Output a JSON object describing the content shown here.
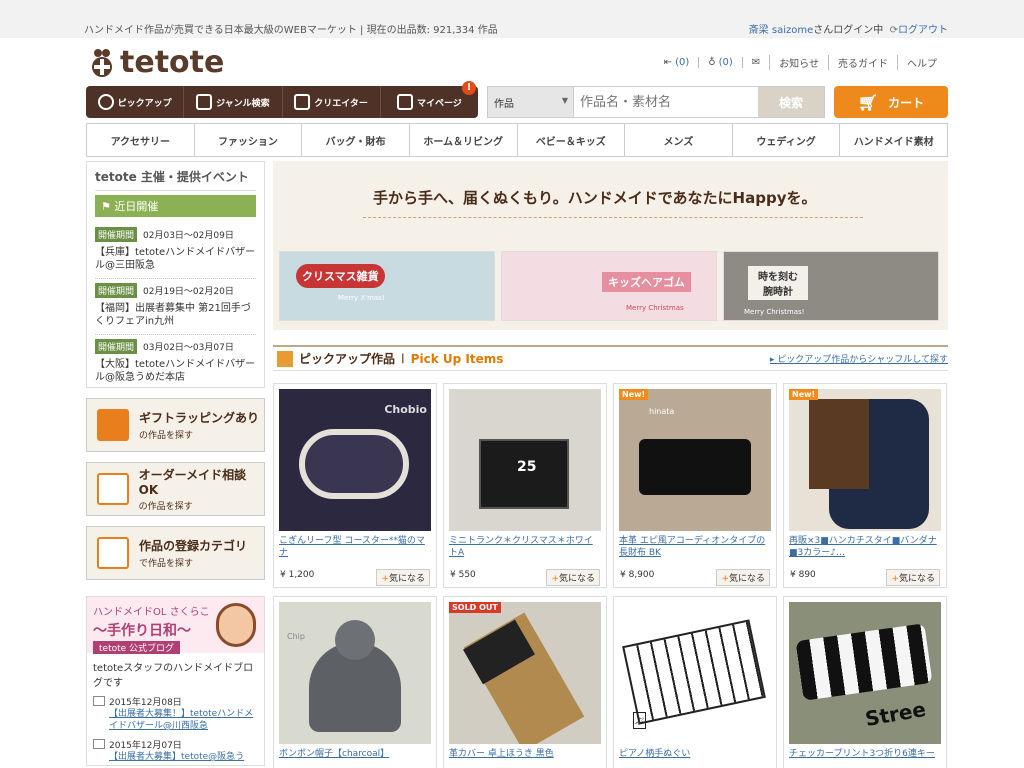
{
  "topbar": {
    "tagline": "ハンドメイド作品が売買できる日本最大級のWEBマーケット",
    "count_label": "現在の出品数: 921,334 作品",
    "user_name": "斎梁 saizome",
    "user_suffix": "さんログイン中",
    "logout": "ログアウト"
  },
  "logo": {
    "text": "tetote"
  },
  "utils": [
    {
      "icon": "inbox-icon",
      "label": "(0)"
    },
    {
      "icon": "bulb-icon",
      "label": "(0)"
    },
    {
      "icon": "mail-icon",
      "label": ""
    },
    {
      "icon": "",
      "label": "お知らせ"
    },
    {
      "icon": "",
      "label": "売るガイド"
    },
    {
      "icon": "",
      "label": "ヘルプ"
    }
  ],
  "nav": [
    {
      "icon": "check-icon",
      "label": "ピックアップ"
    },
    {
      "icon": "genre-icon",
      "label": "ジャンル検索"
    },
    {
      "icon": "creator-icon",
      "label": "クリエイター"
    },
    {
      "icon": "mypage-icon",
      "label": "マイページ"
    }
  ],
  "nav_badge": "!",
  "search": {
    "select": "作品",
    "placeholder": "作品名・素材名",
    "button": "検索"
  },
  "cart": {
    "label": "カート"
  },
  "categories": [
    "アクセサリー",
    "ファッション",
    "バッグ・財布",
    "ホーム＆リビング",
    "ベビー＆キッズ",
    "メンズ",
    "ウェディング",
    "ハンドメイド素材"
  ],
  "events": {
    "title": "tetote 主催・提供イベント",
    "recent": "近日開催",
    "items": [
      {
        "label": "開催期間",
        "date": "02月03日～02月09日",
        "text": "【兵庫】tetoteハンドメイドバザール@三田阪急"
      },
      {
        "label": "開催期間",
        "date": "02月19日～02月20日",
        "text": "【福岡】出展者募集中 第21回手づくりフェアin九州"
      },
      {
        "label": "開催期間",
        "date": "03月02日～03月07日",
        "text": "【大阪】tetoteハンドメイドバザール@阪急うめだ本店"
      }
    ]
  },
  "side_buttons": [
    {
      "title": "ギフトラッピングあり",
      "sub": "の作品を探す",
      "icon": "gift-icon"
    },
    {
      "title": "オーダーメイド相談OK",
      "sub": "の作品を探す",
      "icon": "order-icon"
    },
    {
      "title": "作品の登録カテゴリ",
      "sub": "で作品を探す",
      "icon": "category-search-icon"
    }
  ],
  "blog": {
    "kicker": "ハンドメイドOL さくらこ",
    "title": "～手作り日和～",
    "badge": "tetote 公式ブログ",
    "staff": "tetoteスタッフのハンドメイドブログです",
    "entries": [
      {
        "date": "2015年12月08日",
        "text": "【出展者大募集！】tetoteハンドメイドバザール@川西阪急"
      },
      {
        "date": "2015年12月07日",
        "text": "【出展者大募集】tetote@阪急う"
      }
    ]
  },
  "banner": {
    "tagline": "手から手へ、届くぬくもり。ハンドメイドであなたにHappyを。",
    "items": [
      {
        "title": "クリスマス雑貨",
        "sub": "Merry X'mas!"
      },
      {
        "title": "キッズヘアゴム",
        "sub": "Merry Christmas"
      },
      {
        "title": "時を刻む 腕時計",
        "sub": "Merry Christmas!"
      }
    ]
  },
  "pickup": {
    "title": "ピックアップ作品",
    "en": "Pick Up Items",
    "more": "ピックアップ作品からシャッフルして探す"
  },
  "products": [
    {
      "title": "こぎんリーフ型 コースター**猫のマナ",
      "price": "¥ 1,200",
      "fav": "気になる",
      "flag": "",
      "img_text": "Chobio"
    },
    {
      "title": "ミニトランク＊クリスマス＊ホワイトA",
      "price": "¥ 550",
      "fav": "気になる",
      "flag": "",
      "img_text": "25"
    },
    {
      "title": "本革 エピ風アコーディオンタイプの長財布 BK",
      "price": "¥ 8,900",
      "fav": "気になる",
      "flag": "New!",
      "img_text": "hinata"
    },
    {
      "title": "再販×3■ハンカチスタイ■バンダナ■3カラー♪…",
      "price": "¥ 890",
      "fav": "気になる",
      "flag": "New!",
      "img_text": ""
    },
    {
      "title": "ボンボン帽子【charcoal】",
      "price": "",
      "fav": "",
      "flag": "",
      "img_text": "Chip"
    },
    {
      "title": "革カバー 卓上ほうき 黒色",
      "price": "",
      "fav": "",
      "flag": "SOLD OUT",
      "img_text": ""
    },
    {
      "title": "ピアノ柄手ぬぐい",
      "price": "",
      "fav": "",
      "flag": "",
      "img_text": "ぷ"
    },
    {
      "title": "チェッカープリント3つ折り6連キー",
      "price": "",
      "fav": "",
      "flag": "",
      "img_text": "Stree"
    }
  ]
}
